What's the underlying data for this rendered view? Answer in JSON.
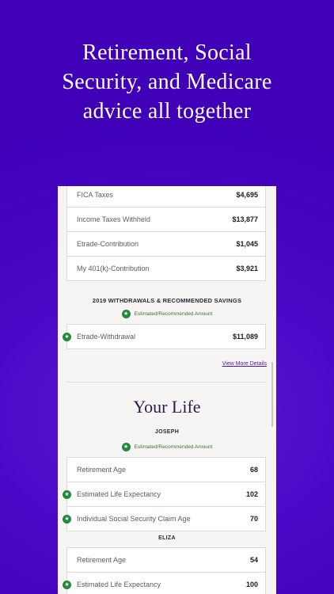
{
  "headline": {
    "line1": "Retirement, Social",
    "line2": "Security, and Medicare",
    "line3": "advice all together"
  },
  "taxes": [
    {
      "label": "FICA Taxes",
      "value": "$4,695"
    },
    {
      "label": "Income Taxes Withheld",
      "value": "$13,877"
    },
    {
      "label": "Etrade-Contribution",
      "value": "$1,045"
    },
    {
      "label": "My 401(k)-Contribution",
      "value": "$3,921"
    }
  ],
  "withdrawals": {
    "title": "2019 WITHDRAWALS & RECOMMENDED SAVINGS",
    "legend": "Estimated/Recommended Amount",
    "rows": [
      {
        "label": "Etrade-Withdrawal",
        "value": "$11,089"
      }
    ],
    "link": "View More Details"
  },
  "your_life": {
    "title": "Your Life",
    "legend": "Estimated/Recommended Amount",
    "joseph": {
      "name": "JOSEPH",
      "rows": [
        {
          "label": "Retirement Age",
          "value": "68"
        },
        {
          "label": "Estimated Life Expectancy",
          "value": "102"
        },
        {
          "label": "Individual Social Security Claim Age",
          "value": "70"
        }
      ]
    },
    "eliza": {
      "name": "ELIZA",
      "rows": [
        {
          "label": "Retirement Age",
          "value": "54"
        },
        {
          "label": "Estimated Life Expectancy",
          "value": "100"
        }
      ]
    }
  },
  "icons": {
    "estimate": "star-icon"
  },
  "colors": {
    "background": "#4b08c8",
    "accent_green": "#1f8a3c",
    "link": "#4b17b5"
  }
}
